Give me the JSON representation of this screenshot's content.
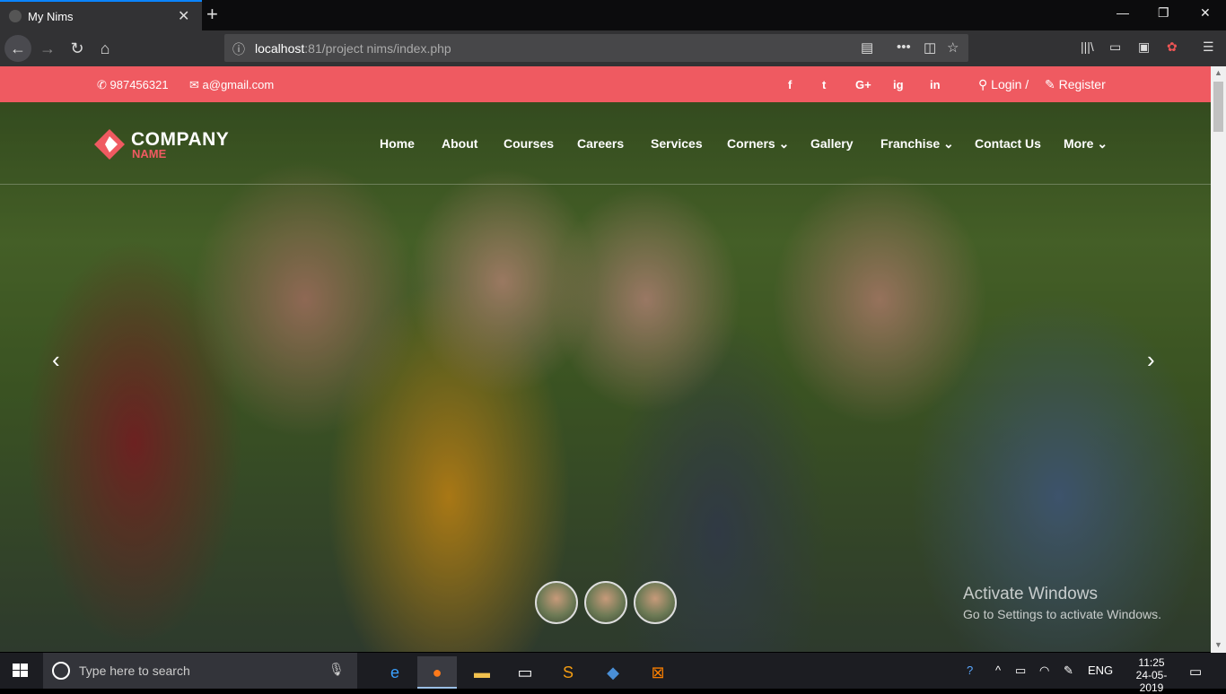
{
  "browser": {
    "tab_title": "My Nims",
    "url_host": "localhost",
    "url_path": ":81/project nims/index.php"
  },
  "topbar": {
    "phone": "987456321",
    "email": "a@gmail.com",
    "social": [
      "f",
      "t",
      "G+",
      "ig",
      "in"
    ],
    "login": "Login /",
    "register": "Register",
    "color": "#ef5a61"
  },
  "logo": {
    "line1": "COMPANY",
    "line2": "NAME"
  },
  "nav": {
    "home": "Home",
    "about": "About",
    "courses": "Courses",
    "careers": "Careers",
    "services": "Services",
    "corners": "Corners",
    "gallery": "Gallery",
    "franchise": "Franchise",
    "contact": "Contact Us",
    "more": "More"
  },
  "watermark": {
    "title": "Activate Windows",
    "subtitle": "Go to Settings to activate Windows."
  },
  "taskbar": {
    "search_placeholder": "Type here to search",
    "lang": "ENG",
    "time": "11:25",
    "date": "24-05-2019"
  }
}
